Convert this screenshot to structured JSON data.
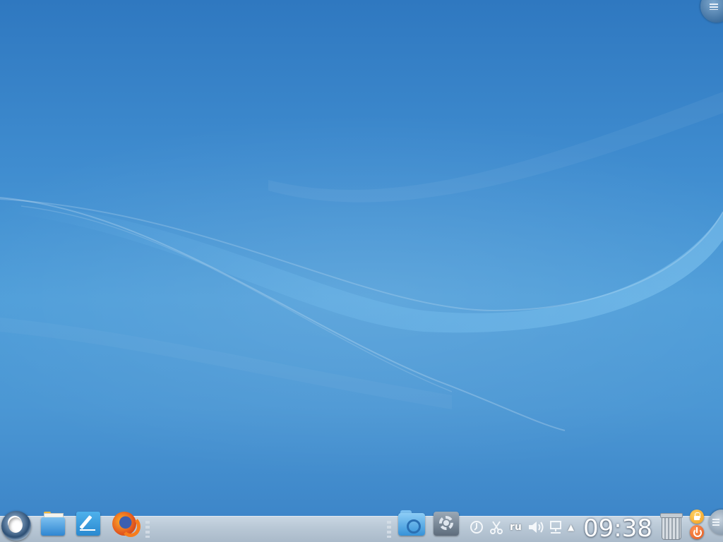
{
  "desktop": {
    "wallpaper": "blue-wave",
    "colors": {
      "top": "#2f78c0",
      "middle": "#4f9ed9",
      "bottom": "#3a82c6"
    }
  },
  "corner_toolbox": {
    "icon": "desktop-toolbox-icon"
  },
  "panel": {
    "launchers": [
      {
        "id": "application-launcher",
        "icon": "application-menu-icon"
      },
      {
        "id": "file-manager",
        "icon": "folder-icon"
      },
      {
        "id": "text-editor",
        "icon": "kwrite-icon"
      },
      {
        "id": "web-browser",
        "icon": "firefox-icon"
      },
      {
        "id": "dolphin",
        "icon": "dolphin-icon"
      },
      {
        "id": "system-settings",
        "icon": "system-settings-icon"
      }
    ],
    "tray": {
      "keyboard_layout": "ru",
      "icons": [
        "klipper-icon",
        "clipboard-cut-icon",
        "volume-icon",
        "network-icon",
        "expand-arrow-icon"
      ]
    },
    "clock": {
      "time": "09:38"
    },
    "trash": {
      "icon": "trash-icon"
    },
    "session": {
      "lock": "lock-icon",
      "leave": "power-icon"
    }
  }
}
